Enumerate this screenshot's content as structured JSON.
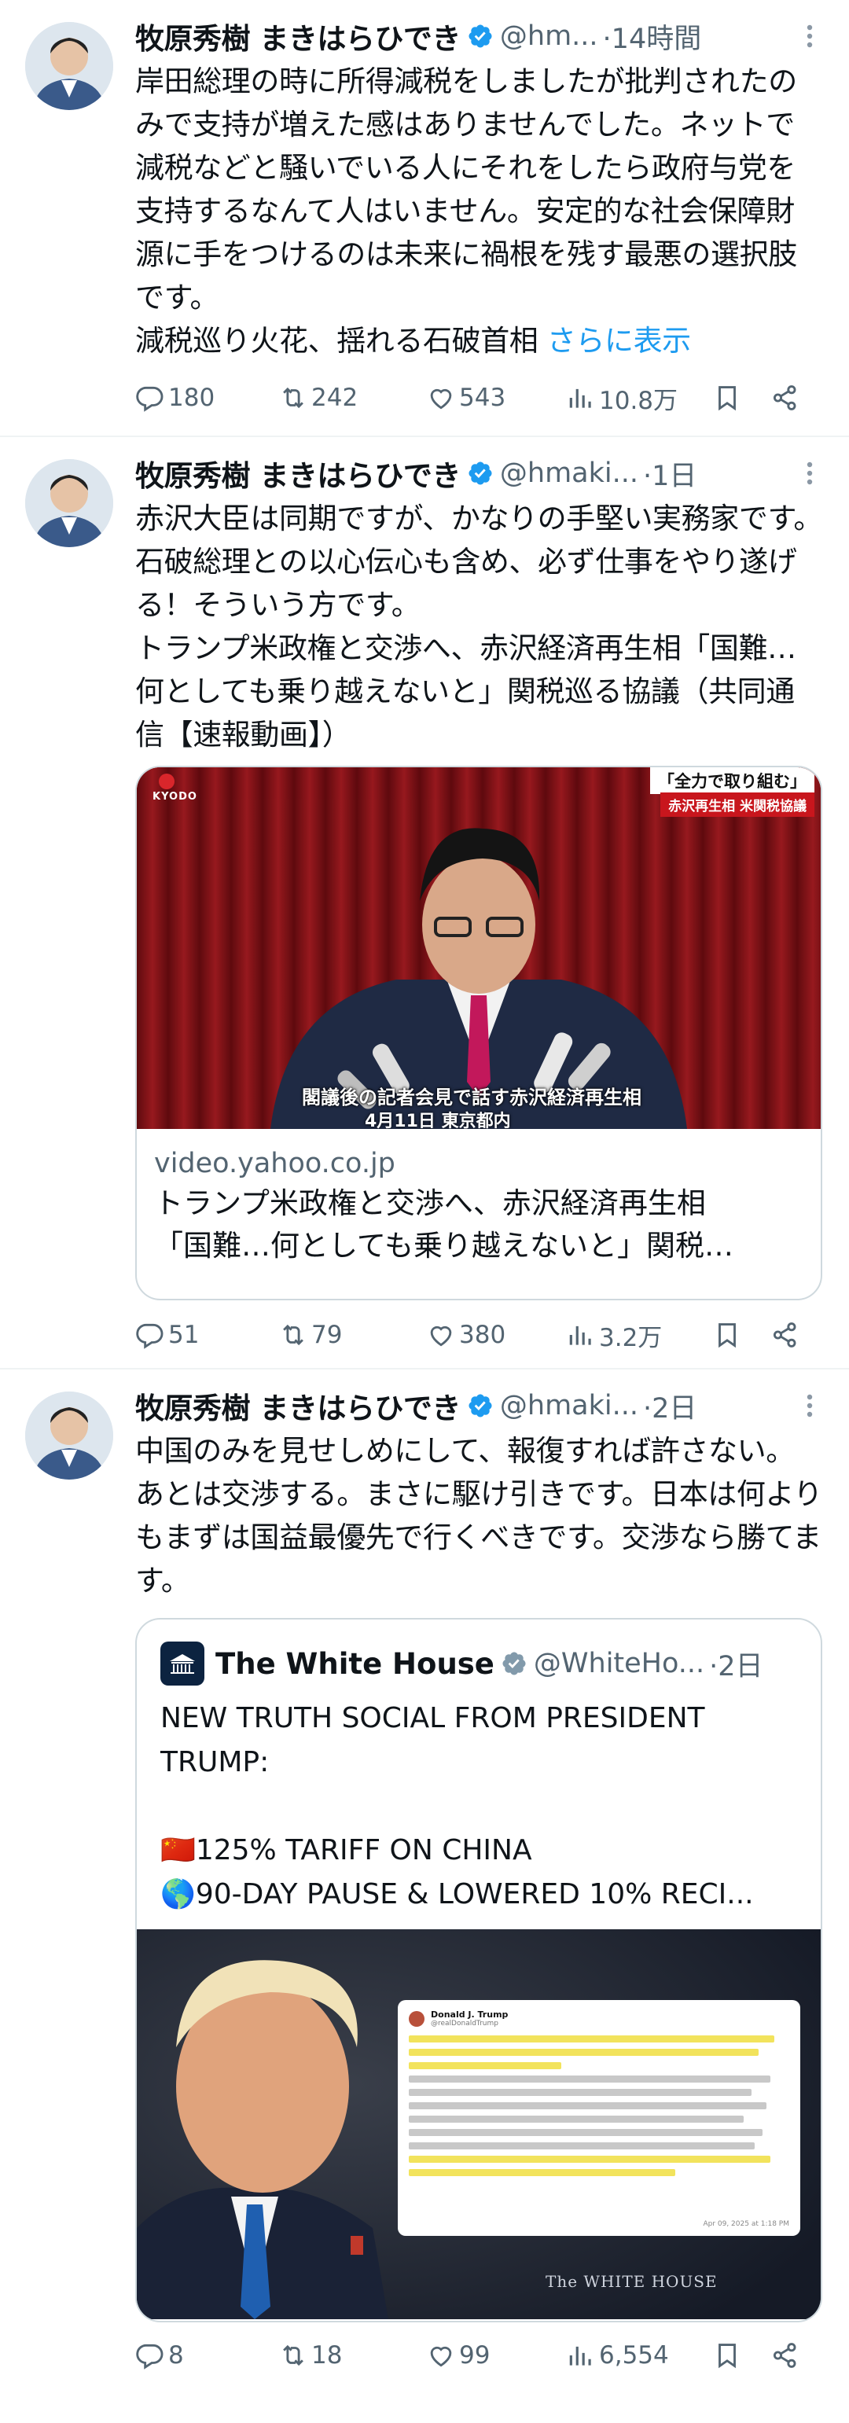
{
  "tweets": [
    {
      "author_name": "牧原秀樹 まきはらひでき",
      "handle": "@hm...",
      "time": "·14時間",
      "text": "岸田総理の時に所得減税をしましたが批判されたのみで支持が増えた感はありませんでした。ネットで減税などと騒いでいる人にそれをしたら政府与党を支持するなんて人はいません。安定的な社会保障財源に手をつけるのは未来に禍根を残す最悪の選択肢です。\n減税巡り火花、揺れる石破首相 ",
      "show_more": "さらに表示",
      "replies": "180",
      "retweets": "242",
      "likes": "543",
      "views": "10.8万"
    },
    {
      "author_name": "牧原秀樹 まきはらひでき",
      "handle": "@hmaki...",
      "time": "·1日",
      "text": "赤沢大臣は同期ですが、かなりの手堅い実務家です。石破総理との以心伝心も含め、必ず仕事をやり遂げる！そういう方です。\nトランプ米政権と交渉へ、赤沢経済再生相「国難…何としても乗り越えないと」関税巡る協議（共同通信【速報動画】）",
      "card": {
        "domain": "video.yahoo.co.jp",
        "title_line1": "トランプ米政権と交渉へ、赤沢経済再生相",
        "title_line2": "「国難…何としても乗り越えないと」関税…",
        "logo": "KYODO",
        "banner_top": "「全力で取り組む」",
        "banner_bottom": "赤沢再生相 米関税協議",
        "caption": "閣議後の記者会見で話す赤沢経済再生相",
        "caption_sub": "4月11日 東京都内"
      },
      "replies": "51",
      "retweets": "79",
      "likes": "380",
      "views": "3.2万"
    },
    {
      "author_name": "牧原秀樹 まきはらひでき",
      "handle": "@hmaki...",
      "time": "·2日",
      "text": "中国のみを見せしめにして、報復すれば許さない。あとは交渉する。まさに駆け引きです。日本は何よりもまずは国益最優先で行くべきです。交渉なら勝てます。",
      "quote": {
        "name": "The White House",
        "handle": "@WhiteHo...",
        "time": "·2日",
        "line1": "NEW TRUTH SOCIAL FROM PRESIDENT TRUMP:",
        "line2": "🇨🇳125% TARIFF ON CHINA",
        "line3": "🌎90-DAY PAUSE & LOWERED 10% RECI...",
        "doc_name": "Donald J. Trump",
        "doc_handle": "@realDonaldTrump",
        "doc_date": "Apr 09, 2025 at 1:18 PM",
        "watermark": "The WHITE HOUSE"
      },
      "replies": "8",
      "retweets": "18",
      "likes": "99",
      "views": "6,554"
    }
  ],
  "colors": {
    "accent": "#1d9bf0",
    "muted": "#536471",
    "text": "#0f1419",
    "divider": "#eff3f4"
  },
  "icons": [
    "reply-icon",
    "retweet-icon",
    "like-icon",
    "views-icon",
    "bookmark-icon",
    "share-icon",
    "verified-badge-icon",
    "more-icon"
  ]
}
